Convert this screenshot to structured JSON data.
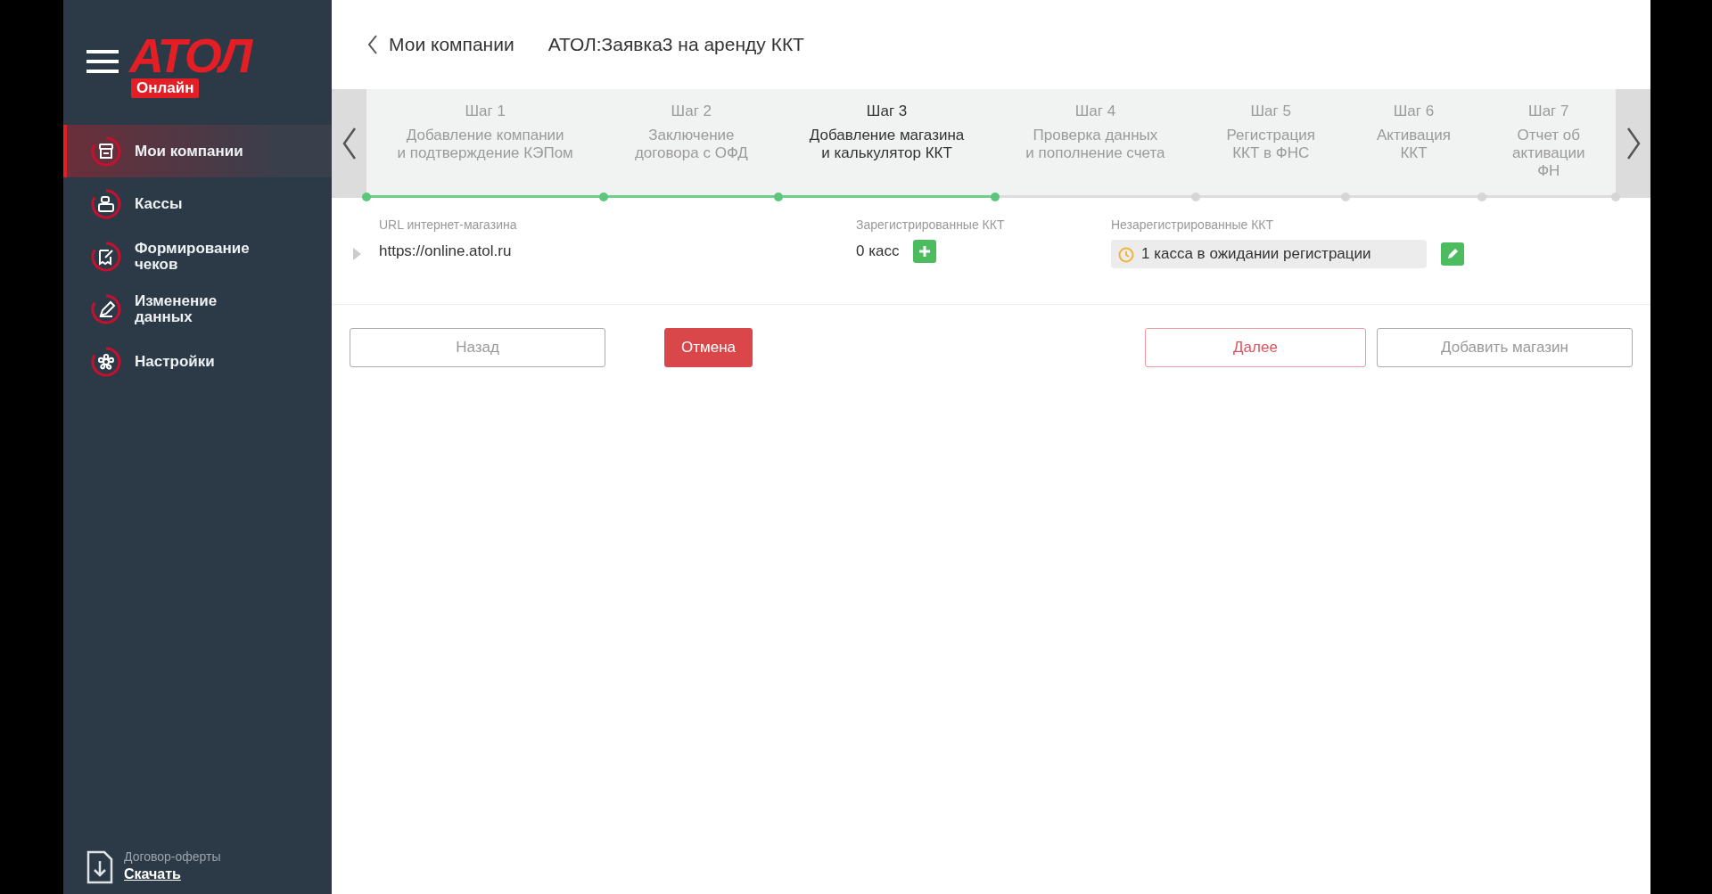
{
  "sidebar": {
    "logo": {
      "title": "АТОЛ",
      "subtitle": "Онлайн"
    },
    "items": [
      {
        "label": "Мои компании",
        "selected": true
      },
      {
        "label": "Кассы",
        "selected": false
      },
      {
        "label": "Формирование\nчеков",
        "selected": false
      },
      {
        "label": "Изменение\nданных",
        "selected": false
      },
      {
        "label": "Настройки",
        "selected": false
      }
    ],
    "footer": {
      "caption": "Договор-оферты",
      "link": "Скачать"
    }
  },
  "header": {
    "back": "Мои компании",
    "title": "АТОЛ:Заявка3 на аренду ККТ"
  },
  "steps": [
    {
      "title": "Шаг 1",
      "description": "Добавление компании\nи подтверждение КЭПом",
      "reached": true,
      "selected": false
    },
    {
      "title": "Шаг 2",
      "description": "Заключение\nдоговора с ОФД",
      "reached": true,
      "selected": false
    },
    {
      "title": "Шаг 3",
      "description": "Добавление магазина\nи калькулятор ККТ",
      "reached": true,
      "selected": true
    },
    {
      "title": "Шаг 4",
      "description": "Проверка данных\nи пополнение счета",
      "reached": true,
      "selected": false
    },
    {
      "title": "Шаг 5",
      "description": "Регистрация\nККТ в ФНС",
      "reached": false,
      "selected": false
    },
    {
      "title": "Шаг 6",
      "description": "Активация\nККТ",
      "reached": false,
      "selected": false
    },
    {
      "title": "Шаг 7",
      "description": "Отчет об\nактивации\nФН",
      "reached": false,
      "selected": false
    }
  ],
  "shop": {
    "url_label": "URL интернет-магазина",
    "url": "https://online.atol.ru",
    "registered_label": "Зарегистрированные ККТ",
    "registered": "0 касс",
    "unregistered_label": "Незарегистрированные ККТ",
    "unregistered": "1 касса в ожидании регистрации"
  },
  "buttons": [
    {
      "label": "Назад",
      "kind": "outline"
    },
    {
      "label": "Отмена",
      "kind": "danger"
    },
    {
      "label": "Далее",
      "kind": "next"
    },
    {
      "label": "Добавить магазин",
      "kind": "outline"
    }
  ]
}
